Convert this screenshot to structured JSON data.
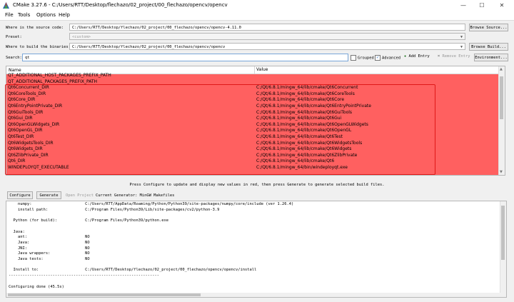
{
  "window": {
    "title": "CMake 3.27.6 - C:/Users/RTT/Desktop/flechazo/02_project/00_flechazo/opencv/opencv",
    "minimize": "—",
    "maximize": "☐",
    "close": "✕"
  },
  "menu": [
    "File",
    "Tools",
    "Options",
    "Help"
  ],
  "source": {
    "label": "Where is the source code:",
    "value": "C:/Users/RTT/Desktop/flechazo/02_project/00_flechazo/opencv/opencv-4.11.0",
    "button": "Browse Source..."
  },
  "preset": {
    "label": "Preset:",
    "value": "<custom>"
  },
  "build": {
    "label": "Where to build the binaries:",
    "value": "C:/Users/RTT/Desktop/flechazo/02_project/00_flechazo/opencv/opencv",
    "button": "Browse Build..."
  },
  "search": {
    "label": "Search:",
    "value": "qt",
    "grouped": "Grouped",
    "advanced": "Advanced",
    "add_entry": "Add Entry",
    "remove_entry": "Remove Entry",
    "environment": "Environment..."
  },
  "tree": {
    "col_name": "Name",
    "col_value": "Value",
    "rows": [
      {
        "name": "QT_ADDITIONAL_HOST_PACKAGES_PREFIX_PATH",
        "value": ""
      },
      {
        "name": "QT_ADDITIONAL_PACKAGES_PREFIX_PATH",
        "value": ""
      },
      {
        "name": "Qt6Concurrent_DIR",
        "value": "C:/Qt/6.8.1/mingw_64/lib/cmake/Qt6Concurrent"
      },
      {
        "name": "Qt6CoreTools_DIR",
        "value": "C:/Qt/6.8.1/mingw_64/lib/cmake/Qt6CoreTools"
      },
      {
        "name": "Qt6Core_DIR",
        "value": "C:/Qt/6.8.1/mingw_64/lib/cmake/Qt6Core"
      },
      {
        "name": "Qt6EntryPointPrivate_DIR",
        "value": "C:/Qt/6.8.1/mingw_64/lib/cmake/Qt6EntryPointPrivate"
      },
      {
        "name": "Qt6GuiTools_DIR",
        "value": "C:/Qt/6.8.1/mingw_64/lib/cmake/Qt6GuiTools"
      },
      {
        "name": "Qt6Gui_DIR",
        "value": "C:/Qt/6.8.1/mingw_64/lib/cmake/Qt6Gui"
      },
      {
        "name": "Qt6OpenGLWidgets_DIR",
        "value": "C:/Qt/6.8.1/mingw_64/lib/cmake/Qt6OpenGLWidgets"
      },
      {
        "name": "Qt6OpenGL_DIR",
        "value": "C:/Qt/6.8.1/mingw_64/lib/cmake/Qt6OpenGL"
      },
      {
        "name": "Qt6Test_DIR",
        "value": "C:/Qt/6.8.1/mingw_64/lib/cmake/Qt6Test"
      },
      {
        "name": "Qt6WidgetsTools_DIR",
        "value": "C:/Qt/6.8.1/mingw_64/lib/cmake/Qt6WidgetsTools"
      },
      {
        "name": "Qt6Widgets_DIR",
        "value": "C:/Qt/6.8.1/mingw_64/lib/cmake/Qt6Widgets"
      },
      {
        "name": "Qt6ZlibPrivate_DIR",
        "value": "C:/Qt/6.8.1/mingw_64/lib/cmake/Qt6ZlibPrivate"
      },
      {
        "name": "Qt6_DIR",
        "value": "C:/Qt/6.8.1/mingw_64/lib/cmake/Qt6"
      },
      {
        "name": "WINDEPLOYQT_EXECUTABLE",
        "value": "C:/Qt/6.8.1/mingw_64/bin/windeployqt.exe"
      }
    ]
  },
  "message": "Press Configure to update and display new values in red, then press Generate to generate selected build files.",
  "actions": {
    "configure": "Configure",
    "generate": "Generate",
    "open_project": "Open Project",
    "current_generator": "Current Generator: MinGW Makefiles"
  },
  "output_lines": [
    "    numpy:                       C:/Users/RTT/AppData/Roaming/Python/Python39/site-packages/numpy/core/include (ver 1.26.4)",
    "    install path:                C:/Program Files/Python39/Lib/site-packages/cv2/python-3.9",
    "",
    "  Python (for build):            C:/Program Files/Python39/python.exe",
    "",
    "  Java:",
    "    ant:                         NO",
    "    Java:                        NO",
    "    JNI:                         NO",
    "    Java wrappers:               NO",
    "    Java tests:                  NO",
    "",
    "  Install to:                    C:/Users/RTT/Desktop/flechazo/02_project/00_flechazo/opencv/opencv/install",
    "-----------------------------------------------------------------",
    "",
    "Configuring done (45.5s)"
  ],
  "colors": {
    "changed_row": "#ff6060",
    "highlight": "#e01818"
  }
}
